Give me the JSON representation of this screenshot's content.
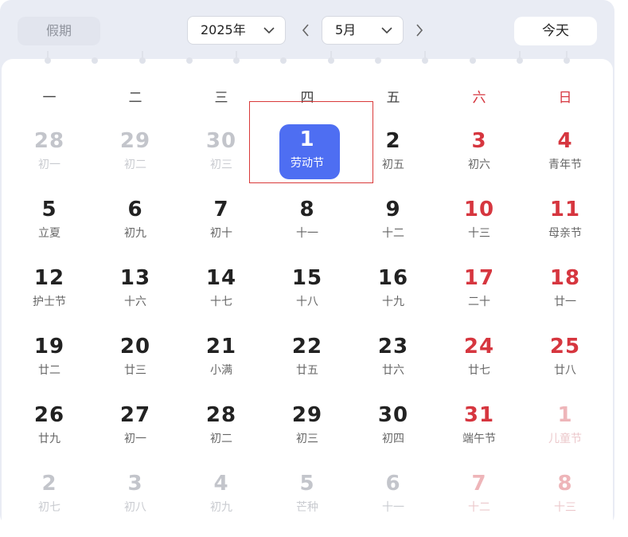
{
  "toolbar": {
    "holiday_label": "假期",
    "year_value": "2025年",
    "month_value": "5月",
    "today_label": "今天",
    "icons": {
      "prev": "chevron-left-icon",
      "next": "chevron-right-icon",
      "dropdown": "chevron-down-icon"
    }
  },
  "weekdays": [
    "一",
    "二",
    "三",
    "四",
    "五",
    "六",
    "日"
  ],
  "colors": {
    "accent": "#4e6ef2",
    "weekend": "#d6363f",
    "highlight_border": "#d93a3a"
  },
  "weeks": [
    [
      {
        "day": "28",
        "lunar": "初一",
        "other": true
      },
      {
        "day": "29",
        "lunar": "初二",
        "other": true
      },
      {
        "day": "30",
        "lunar": "初三",
        "other": true
      },
      {
        "day": "1",
        "lunar": "劳动节",
        "selected": true
      },
      {
        "day": "2",
        "lunar": "初五"
      },
      {
        "day": "3",
        "lunar": "初六"
      },
      {
        "day": "4",
        "lunar": "青年节"
      }
    ],
    [
      {
        "day": "5",
        "lunar": "立夏"
      },
      {
        "day": "6",
        "lunar": "初九"
      },
      {
        "day": "7",
        "lunar": "初十"
      },
      {
        "day": "8",
        "lunar": "十一"
      },
      {
        "day": "9",
        "lunar": "十二"
      },
      {
        "day": "10",
        "lunar": "十三"
      },
      {
        "day": "11",
        "lunar": "母亲节"
      }
    ],
    [
      {
        "day": "12",
        "lunar": "护士节"
      },
      {
        "day": "13",
        "lunar": "十六"
      },
      {
        "day": "14",
        "lunar": "十七"
      },
      {
        "day": "15",
        "lunar": "十八"
      },
      {
        "day": "16",
        "lunar": "十九"
      },
      {
        "day": "17",
        "lunar": "二十"
      },
      {
        "day": "18",
        "lunar": "廿一"
      }
    ],
    [
      {
        "day": "19",
        "lunar": "廿二"
      },
      {
        "day": "20",
        "lunar": "廿三"
      },
      {
        "day": "21",
        "lunar": "小满"
      },
      {
        "day": "22",
        "lunar": "廿五"
      },
      {
        "day": "23",
        "lunar": "廿六"
      },
      {
        "day": "24",
        "lunar": "廿七"
      },
      {
        "day": "25",
        "lunar": "廿八"
      }
    ],
    [
      {
        "day": "26",
        "lunar": "廿九"
      },
      {
        "day": "27",
        "lunar": "初一"
      },
      {
        "day": "28",
        "lunar": "初二"
      },
      {
        "day": "29",
        "lunar": "初三"
      },
      {
        "day": "30",
        "lunar": "初四"
      },
      {
        "day": "31",
        "lunar": "端午节"
      },
      {
        "day": "1",
        "lunar": "儿童节",
        "other": true
      }
    ],
    [
      {
        "day": "2",
        "lunar": "初七",
        "other": true
      },
      {
        "day": "3",
        "lunar": "初八",
        "other": true
      },
      {
        "day": "4",
        "lunar": "初九",
        "other": true
      },
      {
        "day": "5",
        "lunar": "芒种",
        "other": true
      },
      {
        "day": "6",
        "lunar": "十一",
        "other": true
      },
      {
        "day": "7",
        "lunar": "十二",
        "other": true
      },
      {
        "day": "8",
        "lunar": "十三",
        "other": true
      }
    ]
  ]
}
